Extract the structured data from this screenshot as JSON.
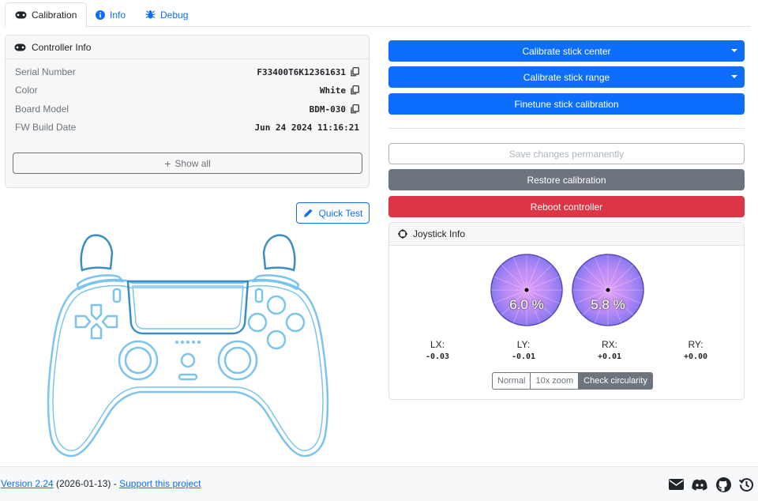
{
  "tabs": [
    {
      "label": "Calibration",
      "icon": "gamepad-icon",
      "active": true
    },
    {
      "label": "Info",
      "icon": "info-icon",
      "active": false
    },
    {
      "label": "Debug",
      "icon": "bug-icon",
      "active": false
    }
  ],
  "controller_info": {
    "title": "Controller Info",
    "rows": [
      {
        "key": "Serial Number",
        "value": "F33400T6K12361631"
      },
      {
        "key": "Color",
        "value": "White"
      },
      {
        "key": "Board Model",
        "value": "BDM-030"
      },
      {
        "key": "FW Build Date",
        "value": "Jun 24 2024 11:16:21"
      }
    ],
    "show_all_label": "Show all"
  },
  "quick_test_label": "Quick Test",
  "actions": {
    "calibrate_center": "Calibrate stick center",
    "calibrate_range": "Calibrate stick range",
    "finetune": "Finetune stick calibration",
    "save": "Save changes permanently",
    "restore": "Restore calibration",
    "reboot": "Reboot controller"
  },
  "joystick_info": {
    "title": "Joystick Info",
    "left_stick_pct": "6.0 %",
    "right_stick_pct": "5.8 %",
    "axes": [
      {
        "label": "LX:",
        "value": "-0.03"
      },
      {
        "label": "LY:",
        "value": "-0.01"
      },
      {
        "label": "RX:",
        "value": "+0.01"
      },
      {
        "label": "RY:",
        "value": "+0.00"
      }
    ],
    "modes": [
      {
        "label": "Normal",
        "active": false
      },
      {
        "label": "10x zoom",
        "active": false
      },
      {
        "label": "Check circularity",
        "active": true
      }
    ]
  },
  "footer": {
    "version_link": "Version 2.24",
    "date": " (2026-01-13) - ",
    "support_link": "Support this project",
    "icons": [
      "mail-icon",
      "discord-icon",
      "github-icon",
      "history-icon"
    ]
  },
  "colors": {
    "primary": "#0d6efd",
    "secondary": "#6c757d",
    "danger": "#dc3545",
    "controller_outline": "#7cc4ec"
  }
}
